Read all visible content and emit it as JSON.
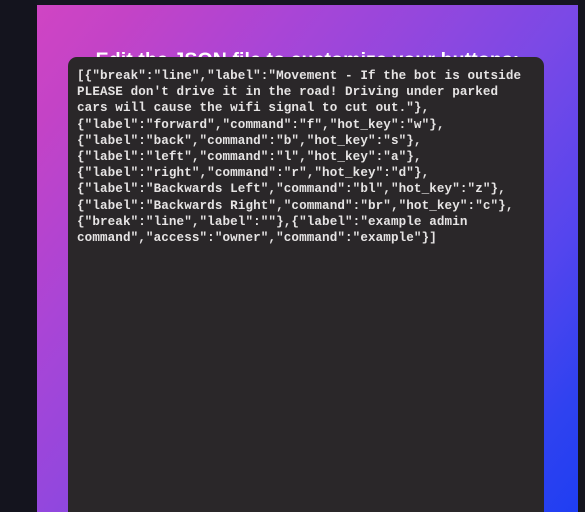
{
  "page": {
    "background_color": "#14141e",
    "gradient_start_color": "#d045c4",
    "gradient_end_color": "#1f3ef2"
  },
  "heading": {
    "title": "Edit the JSON file to customize your buttons:",
    "color": "#ffffff"
  },
  "editor": {
    "background_color": "#2a2729",
    "text_color": "#e6e4e4",
    "content": "[{\"break\":\"line\",\"label\":\"Movement - If the bot is outside PLEASE don't drive it in the road! Driving under parked cars will cause the wifi signal to cut out.\"},\n{\"label\":\"forward\",\"command\":\"f\",\"hot_key\":\"w\"},\n{\"label\":\"back\",\"command\":\"b\",\"hot_key\":\"s\"},\n{\"label\":\"left\",\"command\":\"l\",\"hot_key\":\"a\"},\n{\"label\":\"right\",\"command\":\"r\",\"hot_key\":\"d\"},\n{\"label\":\"Backwards Left\",\"command\":\"bl\",\"hot_key\":\"z\"},\n{\"label\":\"Backwards Right\",\"command\":\"br\",\"hot_key\":\"c\"},\n{\"break\":\"line\",\"label\":\"\"},{\"label\":\"example admin command\",\"access\":\"owner\",\"command\":\"example\"}]"
  }
}
